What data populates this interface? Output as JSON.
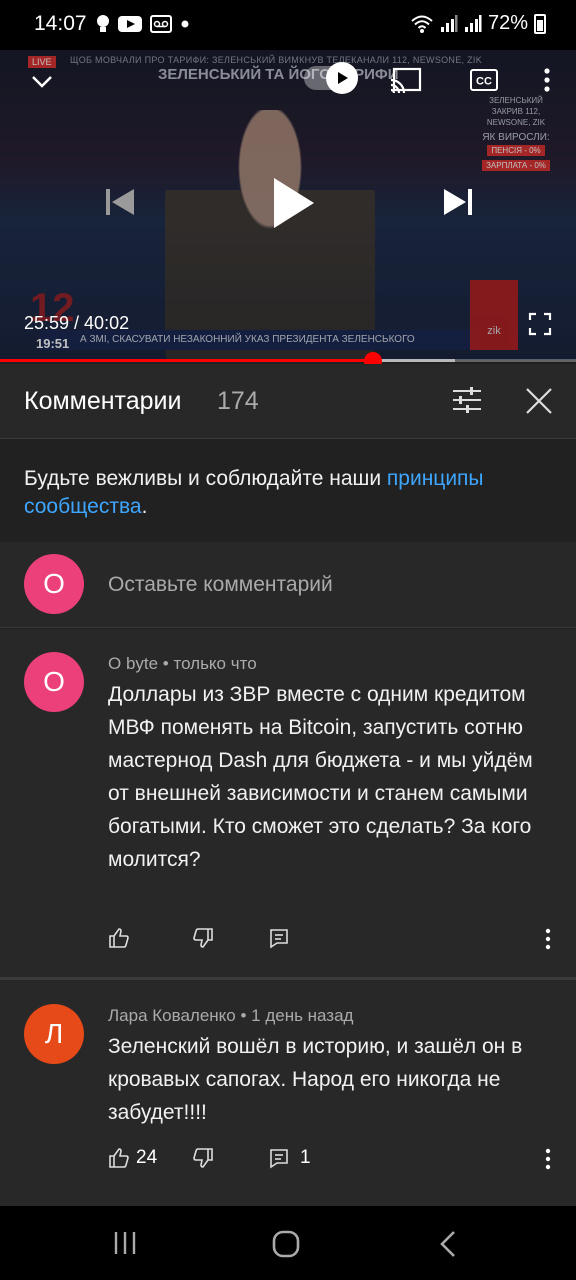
{
  "status_bar": {
    "time": "14:07",
    "battery": "72%",
    "icons": [
      "lightbulb-icon",
      "youtube-icon",
      "voicemail-icon",
      "dot-icon",
      "wifi-icon",
      "signal-icon",
      "signal-icon",
      "battery-icon"
    ]
  },
  "video": {
    "current_time": "25:59",
    "duration": "40:02",
    "time_display": "25:59 / 40:02",
    "progress_fraction": 0.648,
    "buffered_fraction": 0.79,
    "broadcast": {
      "ticker_top": "ЩОБ МОВЧАЛИ ПРО ТАРИФИ: ЗЕЛЕНСЬКИЙ ВИМКНУВ ТЕЛЕКАНАЛИ 112, NEWSONE, ZIK",
      "headline": "ЗЕЛЕНСЬКИЙ ТА ЙОГО ТАРИФИ",
      "live_badge": "LIVE",
      "side_text": "ЗЕЛЕНСЬКИЙ ЗАКРИВ 112, NEWSONE, ZIK",
      "side_question": "ЯК ВИРОСЛИ:",
      "side_pill_1": "ПЕНСІЯ - 0%",
      "side_pill_2": "ЗАРПЛАТА - 0%",
      "bottom_ticker": "А ЗМІ, СКАСУВАТИ НЕЗАКОННИЙ УКАЗ ПРЕЗИДЕНТА ЗЕЛЕНСЬКОГО",
      "clock_big": "12",
      "clock_small": "19:51",
      "channel_logo": "zik"
    }
  },
  "comments_panel": {
    "title": "Комментарии",
    "count": "174",
    "guideline_prefix": "Будьте вежливы и соблюдайте наши ",
    "guideline_link": "принципы сообщества",
    "guideline_suffix": ".",
    "add_comment": {
      "avatar_letter": "O",
      "placeholder": "Оставьте комментарий",
      "avatar_color": "#ec407a"
    },
    "comments": [
      {
        "avatar_letter": "O",
        "avatar_color": "#ec407a",
        "author": "O byte",
        "time": "только что",
        "meta": "O byte • только что",
        "text": "Доллары из ЗВР вместе с одним кредитом МВФ поменять на Bitcoin, запустить сотню мастернод Dash для бюджета - и мы уйдём от внешней зависимости и станем самыми богатыми. Кто сможет это сделать? За кого молится?",
        "likes": "",
        "replies": ""
      },
      {
        "avatar_letter": "Л",
        "avatar_color": "#e64a19",
        "author": "Лара Коваленко",
        "time": "1 день назад",
        "meta": "Лара Коваленко • 1 день назад",
        "text": "Зеленский вошёл в историю, и зашёл он в кровавых сапогах. Народ его никогда не забудет!!!!",
        "likes": "24",
        "replies": "1"
      }
    ]
  },
  "colors": {
    "background": "#212121",
    "panel": "#282828",
    "link": "#3ea6ff",
    "progress": "#ff0000"
  }
}
